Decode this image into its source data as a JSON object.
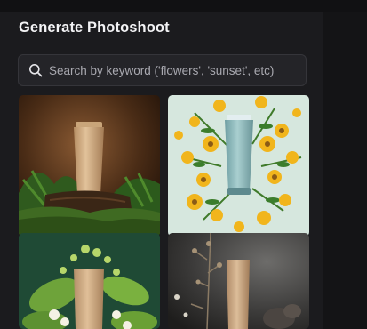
{
  "panel": {
    "title": "Generate Photoshoot"
  },
  "search": {
    "placeholder": "Search by keyword ('flowers', 'sunset', etc)",
    "value": "",
    "icon": "search-icon"
  },
  "colors": {
    "panel_background": "#1b1b1e",
    "page_background": "#151517",
    "search_background": "#242428",
    "title_text": "#f3f3f5"
  },
  "gallery": [
    {
      "scene": "tube on mossy wood with ferns, brown backdrop"
    },
    {
      "scene": "teal tube surrounded by yellow flowers on pale mint backdrop"
    },
    {
      "scene": "tube among green leaves and white blossoms on dark green backdrop"
    },
    {
      "scene": "tube beside dried stems on dark grey backdrop"
    }
  ]
}
